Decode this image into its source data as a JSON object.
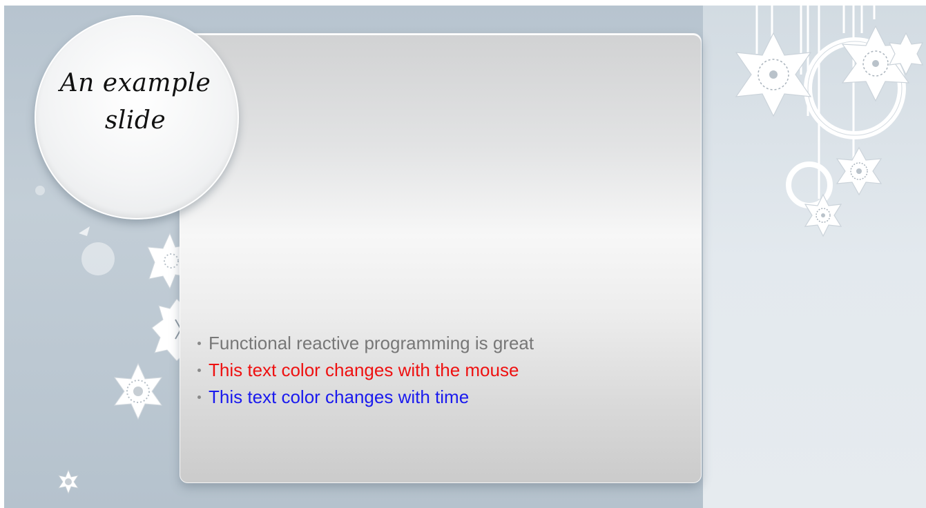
{
  "slide": {
    "title_line1": "An example",
    "title_line2": "slide",
    "bullets": [
      {
        "text": "Functional reactive programming is great",
        "color": "#777777"
      },
      {
        "text": "This text color changes with the mouse",
        "color": "#ee1111"
      },
      {
        "text": "This text color changes with time",
        "color": "#1a1aee"
      }
    ]
  },
  "theme": {
    "background": "#b9c6d1",
    "panel_right": "#e3e9ee",
    "card": "#f2f2f2",
    "snowflake": "#ffffff"
  },
  "icons": [
    "snowflake-icon",
    "ornament-ring-icon"
  ]
}
